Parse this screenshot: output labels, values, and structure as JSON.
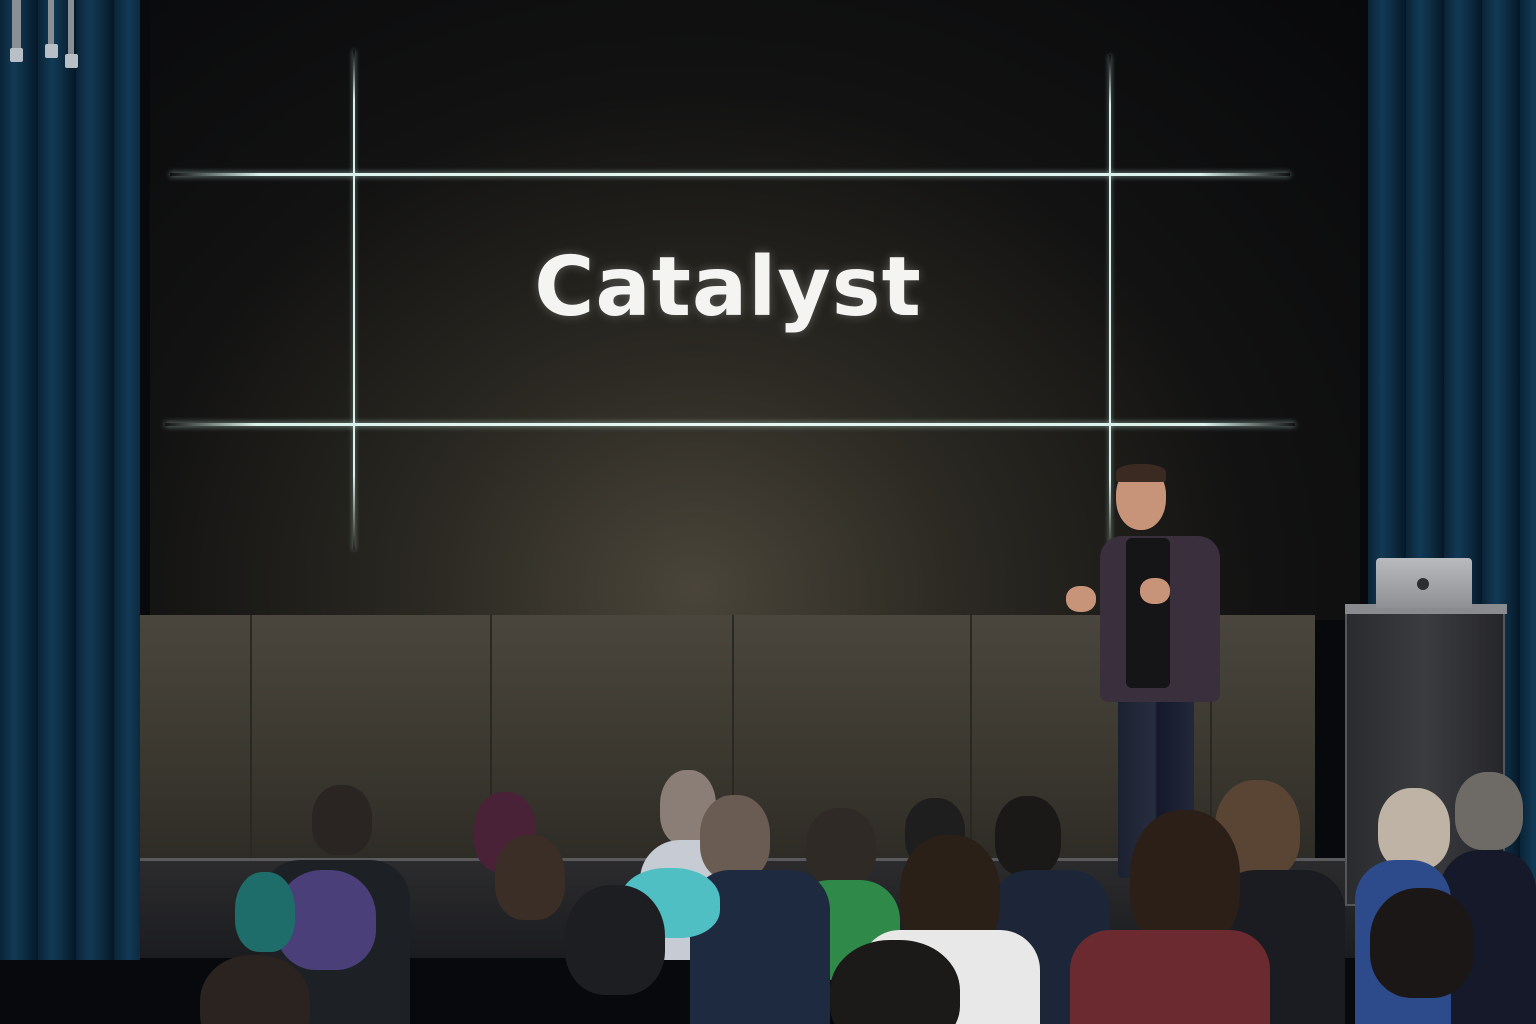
{
  "screen": {
    "title": "Catalyst"
  },
  "colors": {
    "screen_text": "#f4f4f2",
    "grid_lines": "#d9f1ea",
    "curtain": "#123a55",
    "stage_wall": "#4a463e"
  },
  "scene": {
    "description_elements": [
      "stage-screen",
      "presenter",
      "podium",
      "laptop",
      "audience",
      "curtains",
      "stage-lights"
    ]
  }
}
